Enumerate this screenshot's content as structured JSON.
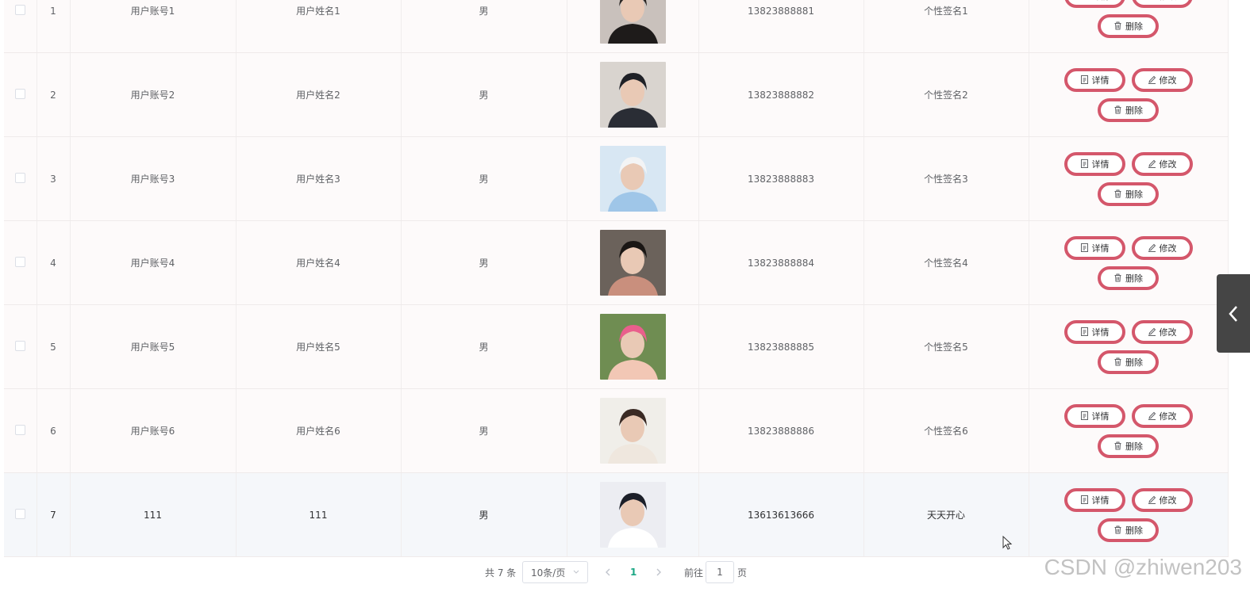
{
  "table": {
    "rows": [
      {
        "index": "1",
        "account": "用户账号1",
        "name": "用户姓名1",
        "gender": "男",
        "avatar": "woman-dark-hair-photo",
        "phone": "13823888881",
        "signature": "个性签名1"
      },
      {
        "index": "2",
        "account": "用户账号2",
        "name": "用户姓名2",
        "gender": "男",
        "avatar": "man-black-shirt-photo",
        "phone": "13823888882",
        "signature": "个性签名2"
      },
      {
        "index": "3",
        "account": "用户账号3",
        "name": "用户姓名3",
        "gender": "男",
        "avatar": "woman-cap-glasses-photo",
        "phone": "13823888883",
        "signature": "个性签名3"
      },
      {
        "index": "4",
        "account": "用户账号4",
        "name": "用户姓名4",
        "gender": "男",
        "avatar": "man-tongue-photo",
        "phone": "13823888884",
        "signature": "个性签名4"
      },
      {
        "index": "5",
        "account": "用户账号5",
        "name": "用户姓名5",
        "gender": "男",
        "avatar": "woman-pink-outdoor-photo",
        "phone": "13823888885",
        "signature": "个性签名5"
      },
      {
        "index": "6",
        "account": "用户账号6",
        "name": "用户姓名6",
        "gender": "男",
        "avatar": "woman-white-coat-photo",
        "phone": "13823888886",
        "signature": "个性签名6"
      },
      {
        "index": "7",
        "account": "111",
        "name": "111",
        "gender": "男",
        "avatar": "man-suit-photo",
        "phone": "13613613666",
        "signature": "天天开心"
      }
    ],
    "actions": {
      "detail": "详情",
      "edit": "修改",
      "delete": "删除"
    }
  },
  "pagination": {
    "total": "共 7 条",
    "page_size": "10条/页",
    "current_page": "1",
    "goto_label": "前往",
    "goto_value": "1",
    "page_suffix": "页"
  },
  "watermark": "CSDN @zhiwen203",
  "colors": {
    "button_border": "#d4576b",
    "active_page": "#1ba784",
    "side_tab": "#454545"
  }
}
